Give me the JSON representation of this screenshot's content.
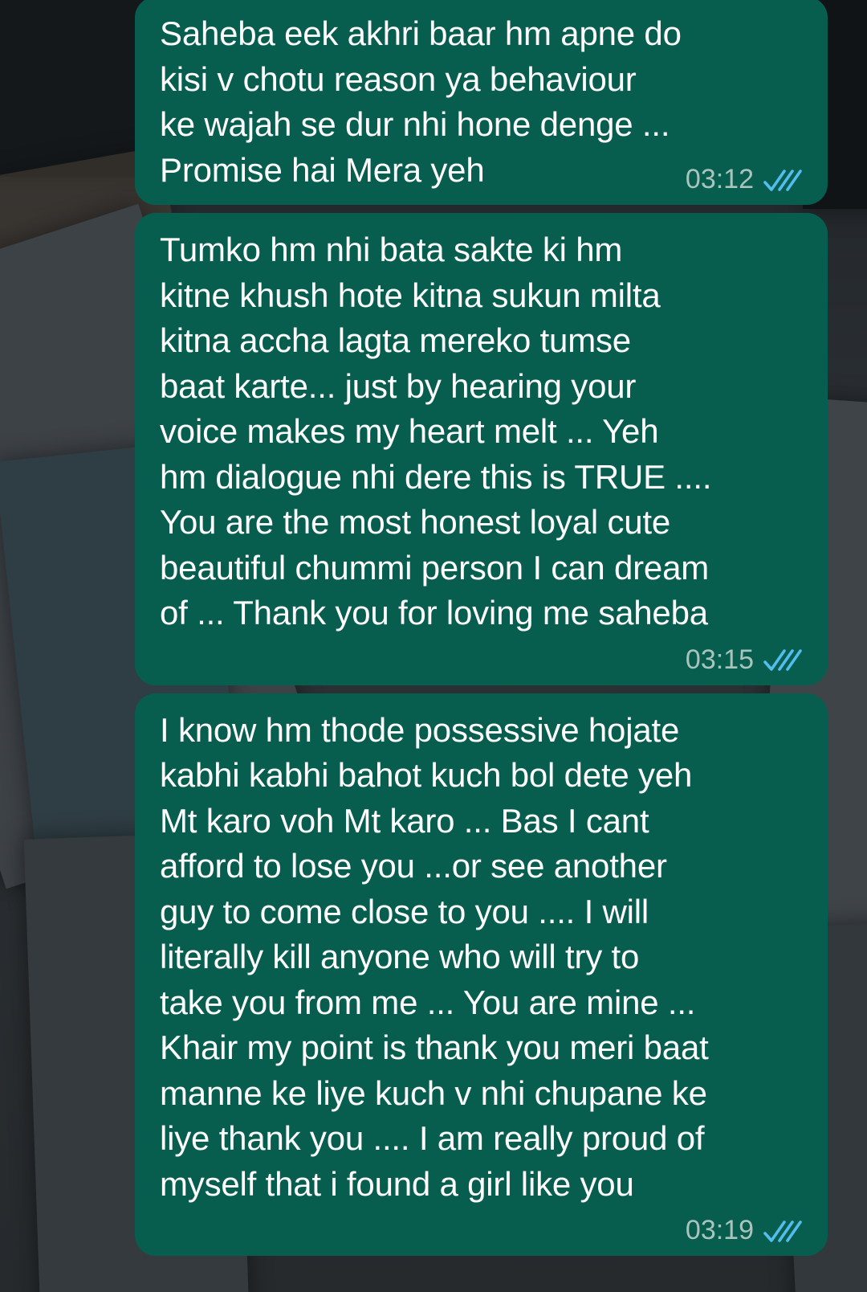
{
  "messages": [
    {
      "text": "Saheba eek akhri baar hm apne do\nkisi v chotu reason ya behaviour\nke wajah se dur nhi hone denge ...\nPromise hai Mera yeh",
      "time": "03:12",
      "status": "read",
      "status_icon": "double-check-icon"
    },
    {
      "text": "Tumko hm nhi bata sakte ki hm\nkitne khush hote kitna sukun milta\nkitna accha lagta mereko tumse\nbaat karte... just by hearing your\nvoice makes my heart melt ... Yeh\nhm dialogue nhi dere this is TRUE ....\nYou are the most honest loyal cute\nbeautiful chummi person I can dream\nof ... Thank you for loving me saheba",
      "time": "03:15",
      "status": "read",
      "status_icon": "double-check-icon"
    },
    {
      "text": "I know hm thode possessive hojate\nkabhi kabhi bahot kuch bol dete yeh\nMt karo voh Mt karo ... Bas I cant\nafford to lose you ...or see another\nguy to come close to you .... I will\nliterally kill anyone who will try to\ntake you from me ... You are mine ...\nKhair my point is thank you meri baat\nmanne ke liye kuch v nhi chupane ke\nliye thank you .... I am really proud of\nmyself that i found a girl like you",
      "time": "03:19",
      "status": "read",
      "status_icon": "double-check-icon"
    }
  ],
  "colors": {
    "bubble_outgoing": "#075e4f",
    "text": "#ffffff",
    "timestamp": "#a9c4bd",
    "read_ticks": "#53bdeb"
  }
}
